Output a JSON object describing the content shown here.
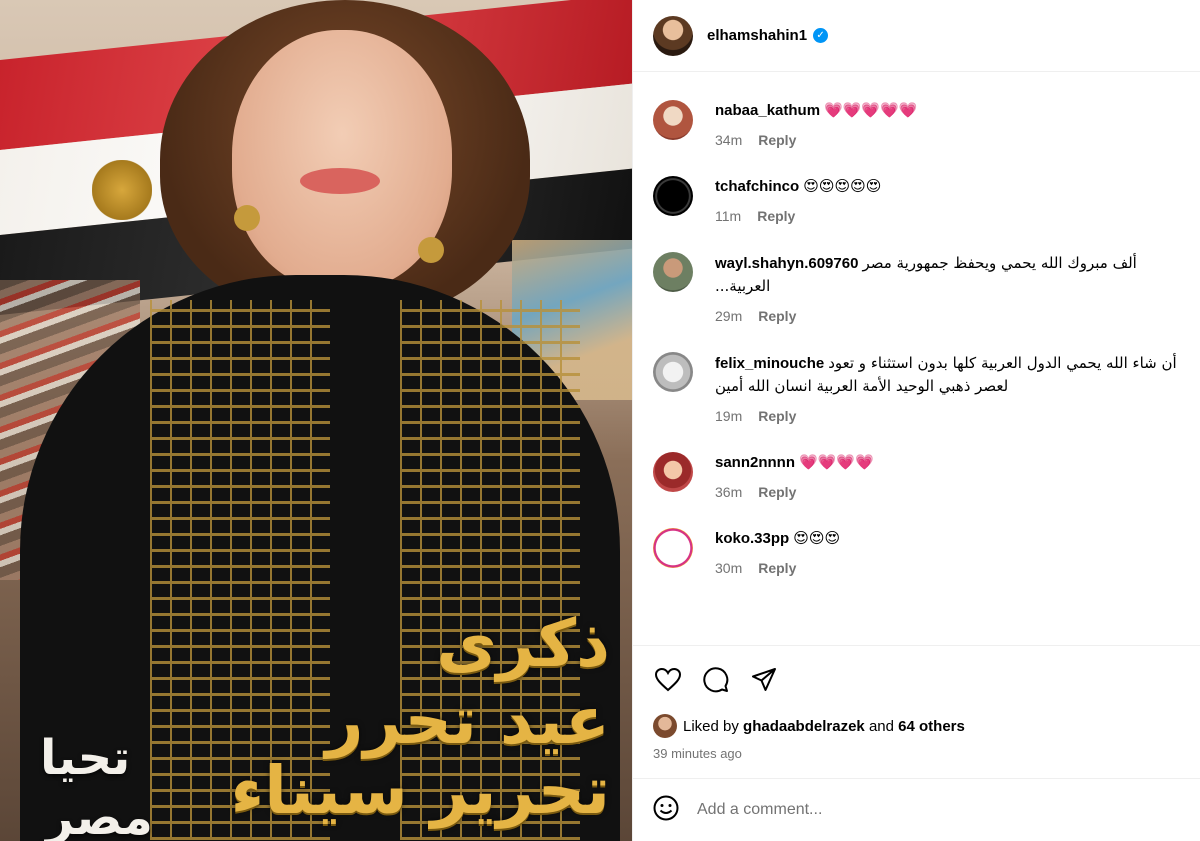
{
  "post": {
    "poster_text": {
      "line1": "ذكرى",
      "line2": "عيد تحرر",
      "line3": "تحرير سيناء",
      "side1": "تحيا",
      "side2": "مصر"
    }
  },
  "header": {
    "username": "elhamshahin1",
    "verified_glyph": "✓"
  },
  "comments": [
    {
      "user": "nabaa_kathum",
      "text": "💗💗💗💗💗",
      "time": "34m",
      "reply": "Reply",
      "rtl": false
    },
    {
      "user": "tchafchinco",
      "text": "😍😍😍😍😍",
      "time": "11m",
      "reply": "Reply",
      "rtl": false
    },
    {
      "user": "wayl.shahyn.609760",
      "text": "ألف مبروك الله يحمي ويحفظ جمهورية مصر العربية...",
      "time": "29m",
      "reply": "Reply",
      "rtl": true
    },
    {
      "user": "felix_minouche",
      "text": "أن شاء الله يحمي الدول العربية كلها بدون استثناء و تعود لعصر ذهبي الوحيد الأمة العربية انسان الله أمين",
      "time": "19m",
      "reply": "Reply",
      "rtl": true
    },
    {
      "user": "sann2nnnn",
      "text": "💗💗💗💗",
      "time": "36m",
      "reply": "Reply",
      "rtl": false
    },
    {
      "user": "koko.33pp",
      "text": "😍😍😍",
      "time": "30m",
      "reply": "Reply",
      "rtl": false
    }
  ],
  "actions": {
    "icons": [
      "heart-icon",
      "comment-icon",
      "share-icon"
    ]
  },
  "likes": {
    "prefix": "Liked by",
    "user": "ghadaabdelrazek",
    "connector": "and",
    "others": "64 others"
  },
  "time_ago": "39 minutes ago",
  "add_comment": {
    "placeholder": "Add a comment..."
  },
  "colors": {
    "verified": "#0095f6",
    "meta": "#737373",
    "border": "#efefef",
    "poster_gold": "#e5b444"
  }
}
